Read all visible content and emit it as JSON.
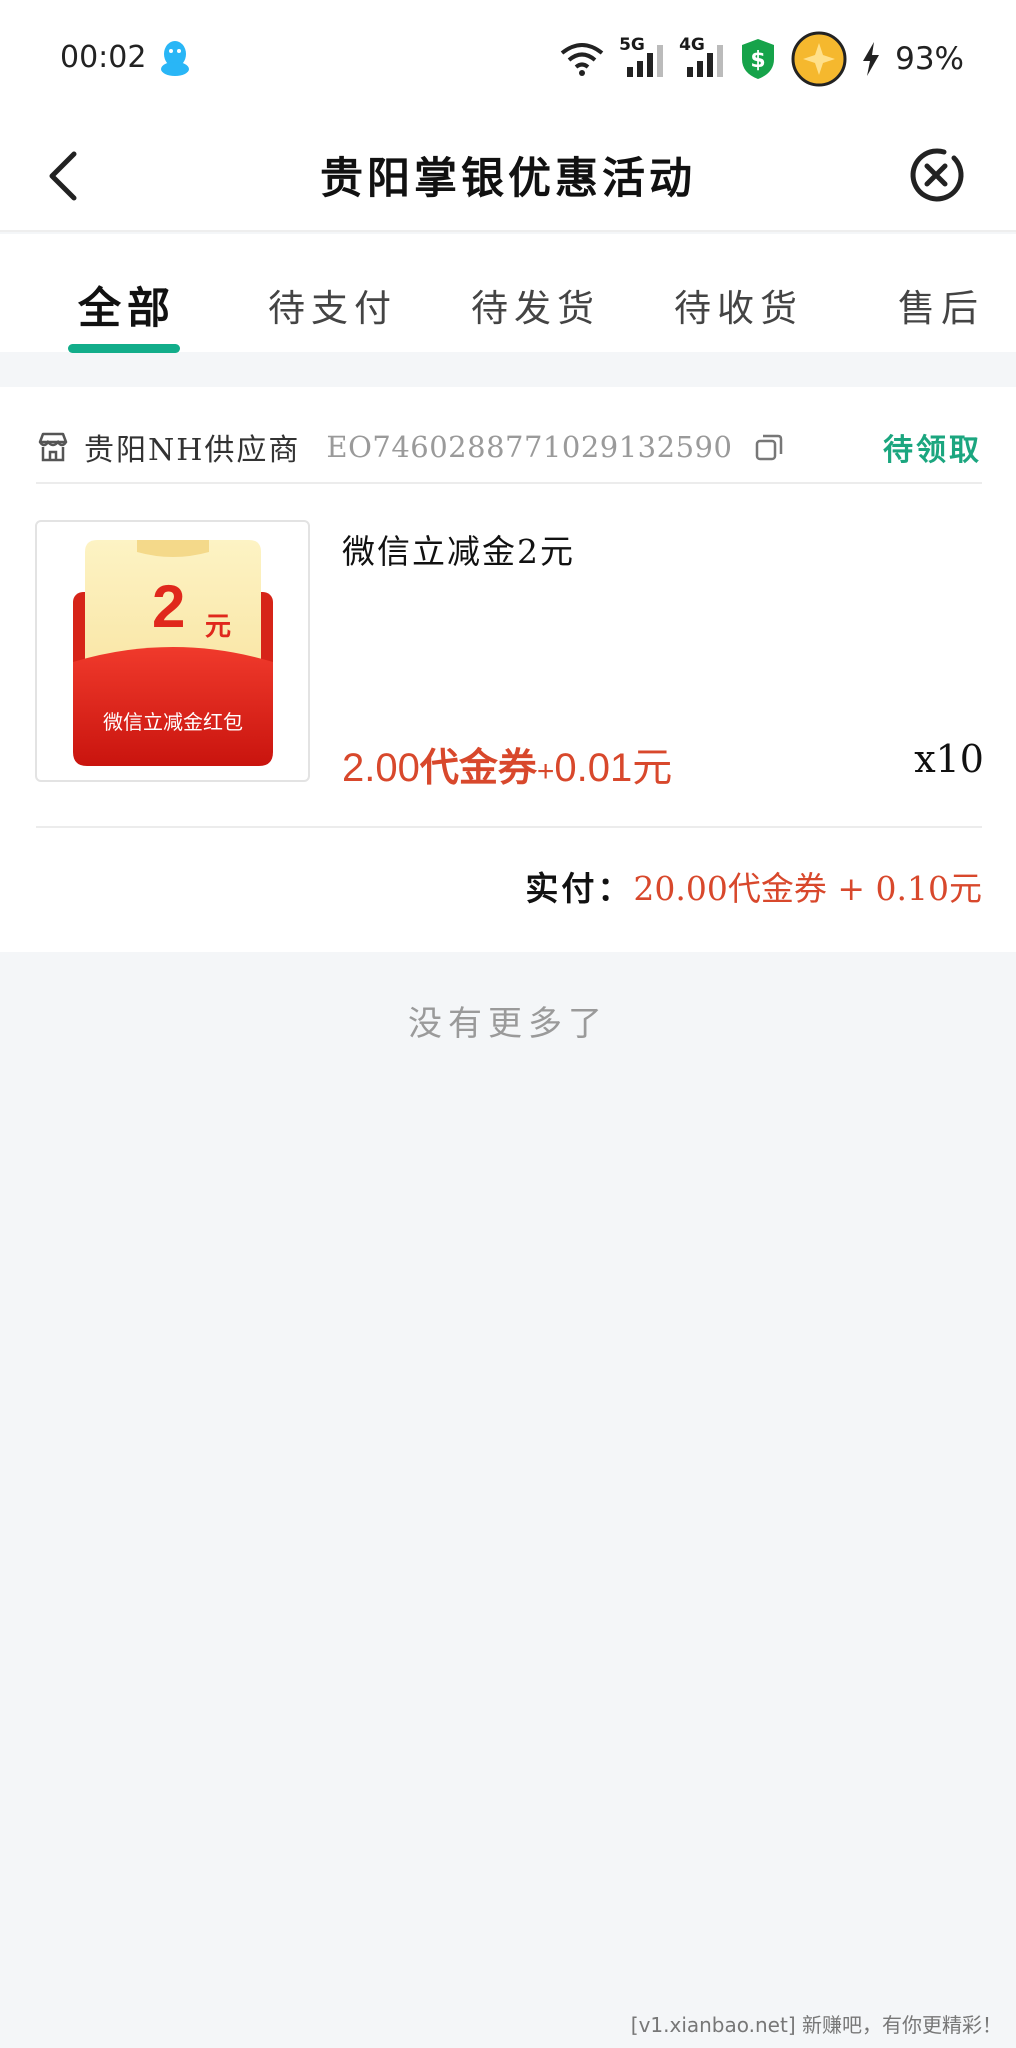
{
  "status_bar": {
    "time": "00:02",
    "network_1": "5G",
    "network_2": "4G",
    "battery": "93%",
    "icons": [
      "qq-penguin-icon",
      "wifi-icon",
      "signal-5g-icon",
      "signal-4g-icon",
      "dollar-shield-icon",
      "coin-icon",
      "charging-icon"
    ]
  },
  "nav": {
    "title": "贵阳掌银优惠活动",
    "back_icon": "chevron-left-icon",
    "close_icon": "close-circle-icon"
  },
  "tabs": [
    {
      "label": "全部",
      "active": true
    },
    {
      "label": "待支付",
      "active": false
    },
    {
      "label": "待发货",
      "active": false
    },
    {
      "label": "待收货",
      "active": false
    },
    {
      "label": "售后",
      "active": false
    }
  ],
  "order": {
    "shop_name": "贵阳NH供应商",
    "order_no": "EO7460288771029132590",
    "status": "待领取",
    "product": {
      "thumb_amount": "2",
      "thumb_unit": "元",
      "thumb_caption": "微信立减金红包",
      "name": "微信立减金2元",
      "price_main": "2.00",
      "price_unit": "代金券",
      "price_plus": "+",
      "price_cash": "0.01元",
      "quantity": "x10"
    },
    "total_label": "实付：",
    "total_value": "20.00代金券 + 0.10元"
  },
  "footer_text": "没有更多了",
  "watermark": "[v1.xianbao.net] 新赚吧，有你更精彩！",
  "colors": {
    "accent_green": "#12ad8a",
    "status_green": "#1ba67f",
    "price_red": "#d8482c"
  }
}
